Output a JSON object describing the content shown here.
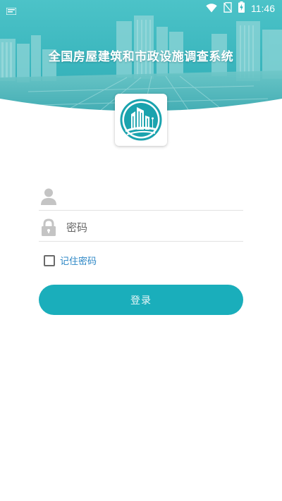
{
  "status_bar": {
    "time": "11:46",
    "icons": [
      "notification-icon",
      "wifi-icon",
      "no-sim-icon",
      "battery-charging-icon"
    ]
  },
  "header": {
    "title": "全国房屋建筑和市政设施调查系统"
  },
  "logo": {
    "icon": "building-logo-icon"
  },
  "form": {
    "username": {
      "value": "",
      "placeholder": "",
      "icon": "user-icon"
    },
    "password": {
      "value": "",
      "placeholder": "密码",
      "icon": "lock-icon"
    },
    "remember_label": "记住密码",
    "remember_checked": false,
    "login_label": "登录"
  },
  "colors": {
    "accent": "#1aaebb",
    "link": "#2b86c5",
    "banner_tint": "#2bb3bd"
  }
}
